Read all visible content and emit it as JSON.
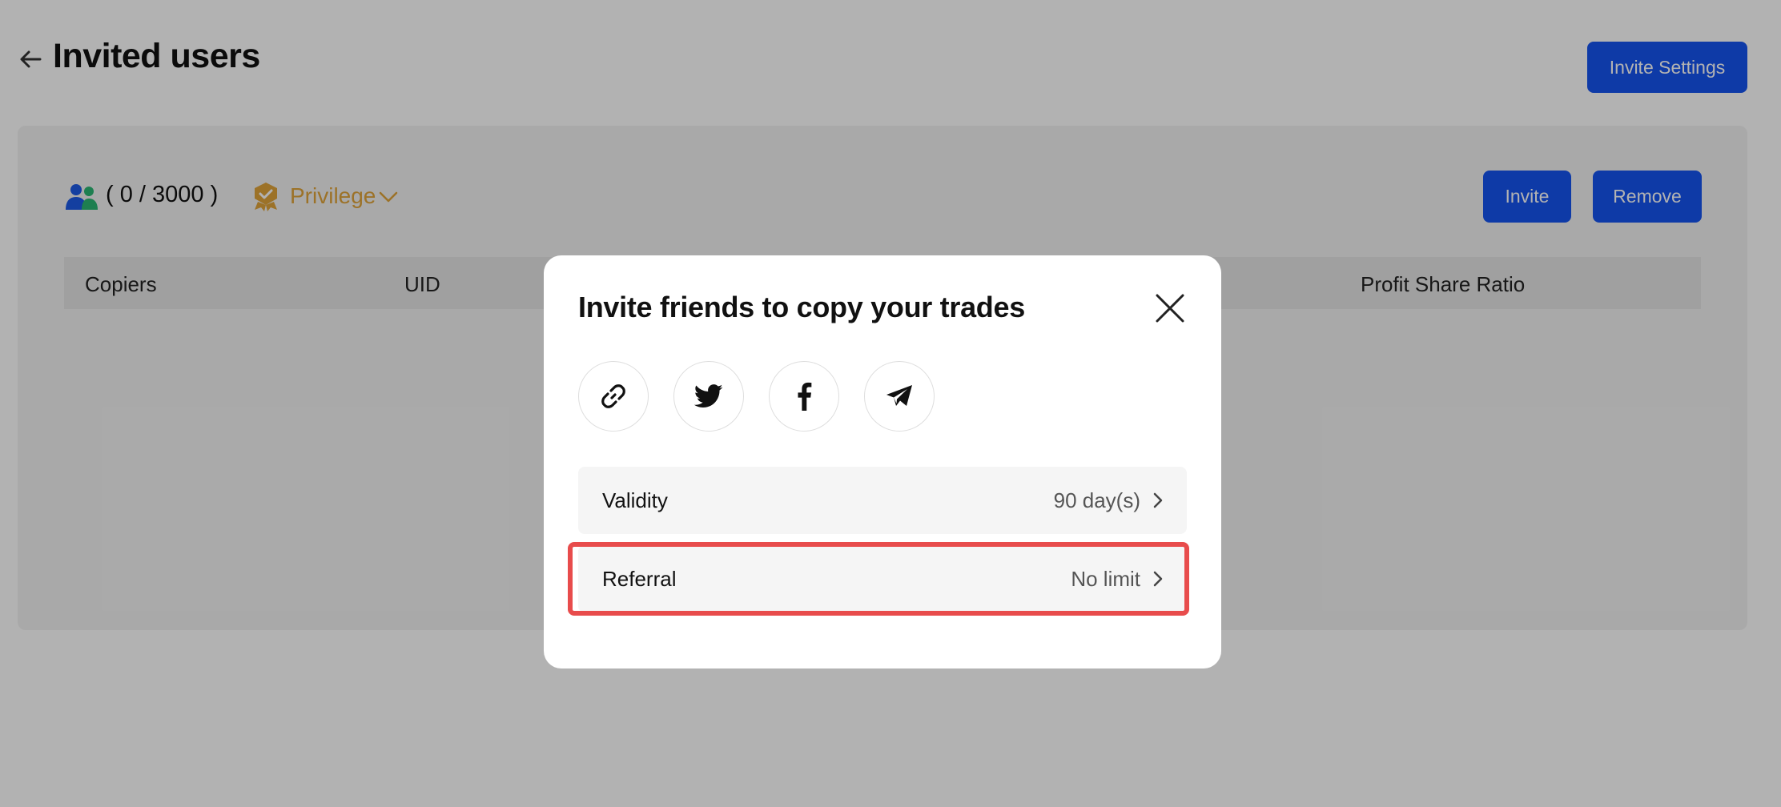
{
  "header": {
    "title": "Invited users",
    "invite_settings_label": "Invite Settings"
  },
  "summary": {
    "count_text": "( 0 / 3000 )",
    "privilege_label": "Privilege"
  },
  "actions": {
    "invite_label": "Invite",
    "remove_label": "Remove"
  },
  "table": {
    "columns": [
      "Copiers",
      "UID",
      "Profit Share Ratio"
    ]
  },
  "modal": {
    "title": "Invite friends to copy your trades",
    "share_icons": [
      "link-icon",
      "twitter-icon",
      "facebook-icon",
      "telegram-icon"
    ],
    "rows": [
      {
        "label": "Validity",
        "value": "90 day(s)"
      },
      {
        "label": "Referral",
        "value": "No limit"
      }
    ]
  },
  "colors": {
    "primary": "#1554f0",
    "privilege": "#e0a43a",
    "highlight": "#e84c4c"
  }
}
